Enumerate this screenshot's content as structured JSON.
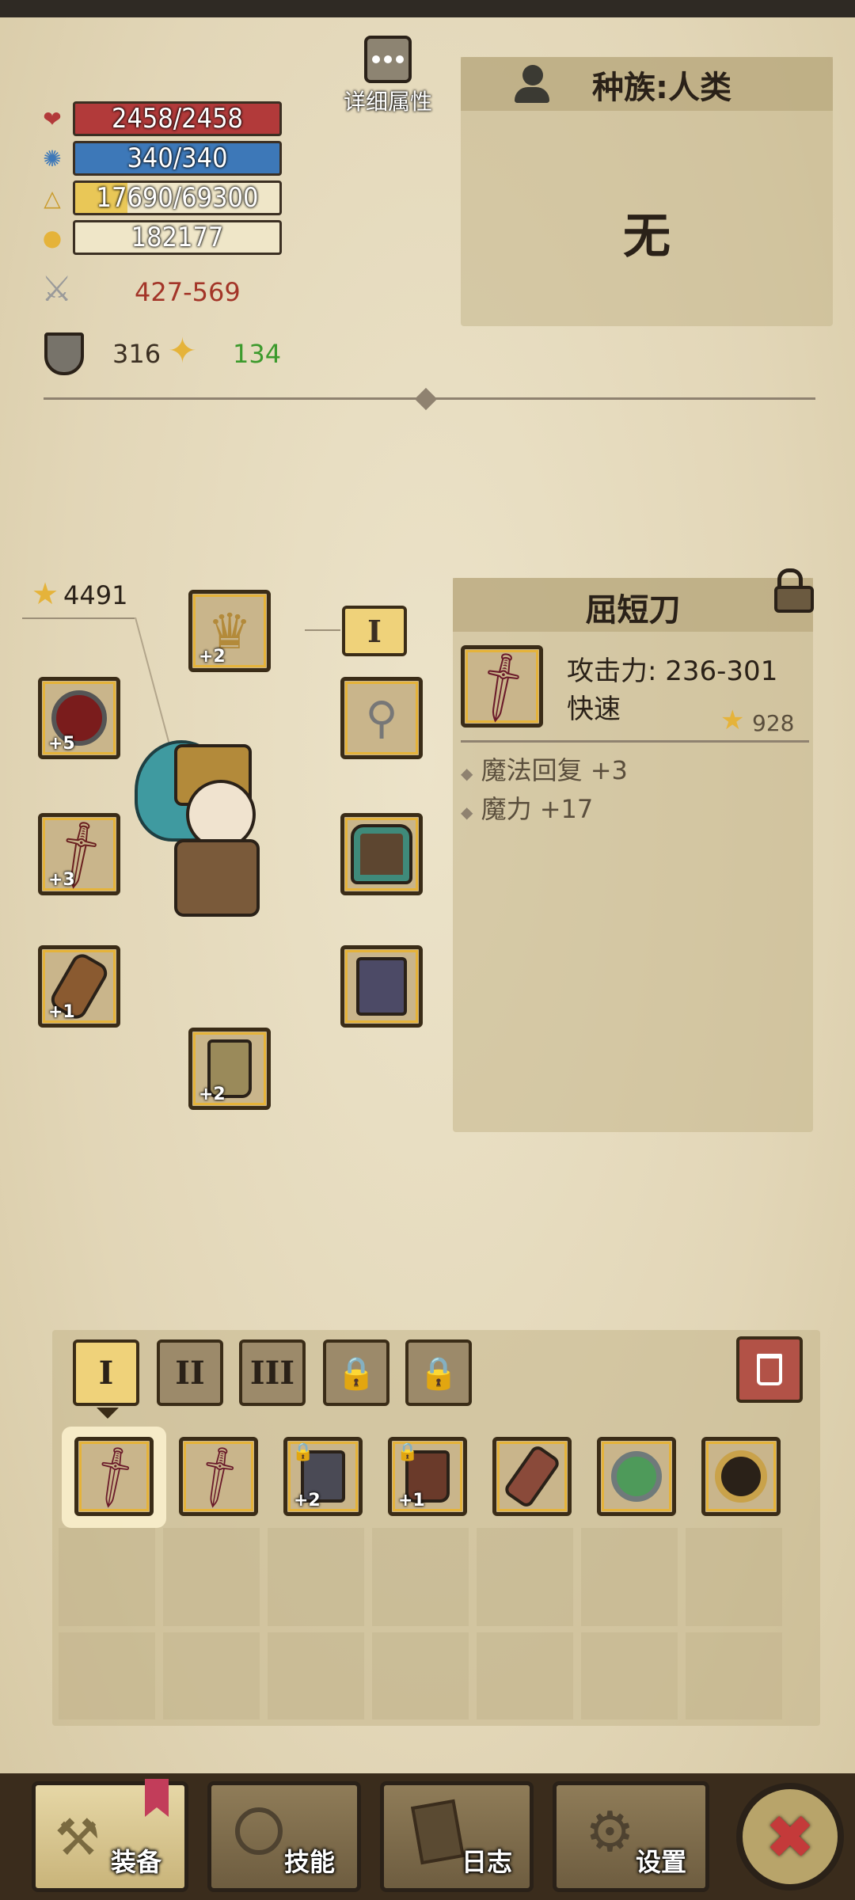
{
  "stats": {
    "hp": "2458/2458",
    "mp": "340/340",
    "exp": "17690/69300",
    "gold": "182177",
    "attack": "427-569",
    "armor": "316",
    "magic_resist": "134",
    "detail_label": "详细属性"
  },
  "race": {
    "label": "种族:人类",
    "title": "无"
  },
  "equip": {
    "rating": "4491",
    "set_index": "I",
    "slots": [
      {
        "slot": "helmet",
        "plus": "+2"
      },
      {
        "slot": "ring",
        "plus": "+5"
      },
      {
        "slot": "weapon",
        "plus": "+3"
      },
      {
        "slot": "gloves",
        "plus": "+1"
      },
      {
        "slot": "boots",
        "plus": "+2"
      },
      {
        "slot": "necklace",
        "plus": ""
      },
      {
        "slot": "armor",
        "plus": ""
      },
      {
        "slot": "pants",
        "plus": ""
      }
    ]
  },
  "item": {
    "name": "屈短刀",
    "attack": "攻击力: 236-301",
    "speed": "快速",
    "rating": "928",
    "attrs": [
      "魔法回复 +3",
      "魔力 +17"
    ]
  },
  "tabs": [
    {
      "label": "I",
      "locked": false,
      "active": true
    },
    {
      "label": "II",
      "locked": false,
      "active": false
    },
    {
      "label": "III",
      "locked": false,
      "active": false
    },
    {
      "label": "",
      "locked": true
    },
    {
      "label": "",
      "locked": true
    }
  ],
  "inventory": [
    {
      "name": "curved-blade",
      "plus": ""
    },
    {
      "name": "curved-blade",
      "plus": ""
    },
    {
      "name": "locked-pants",
      "plus": "+2"
    },
    {
      "name": "locked-boots",
      "plus": "+1"
    },
    {
      "name": "bracer",
      "plus": ""
    },
    {
      "name": "green-ring",
      "plus": ""
    },
    {
      "name": "gold-ring",
      "plus": ""
    }
  ],
  "nav": {
    "equip": "装备",
    "skills": "技能",
    "log": "日志",
    "settings": "设置"
  },
  "colors": {
    "hp": "#b23a3a",
    "mp": "#3d78b8",
    "exp": "#e9d9a6",
    "gold_bar": "#efe6c8",
    "frame": "#e5b33a",
    "attack_text": "#a33528",
    "mres_text": "#3c9a2c"
  }
}
